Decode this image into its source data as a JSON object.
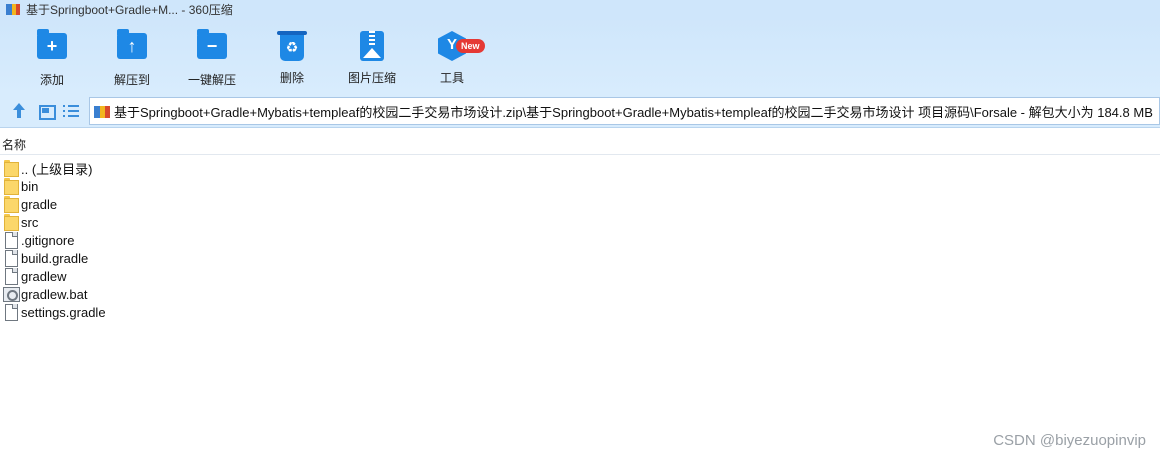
{
  "window": {
    "title": "基于Springboot+Gradle+M... - 360压缩",
    "app_icon": "zip-archive-icon"
  },
  "toolbar": {
    "buttons": [
      {
        "label": "添加",
        "icon": "add-folder-icon"
      },
      {
        "label": "解压到",
        "icon": "extract-to-icon"
      },
      {
        "label": "一键解压",
        "icon": "one-click-extract-icon"
      },
      {
        "label": "删除",
        "icon": "recycle-bin-icon"
      },
      {
        "label": "图片压缩",
        "icon": "image-compress-icon"
      },
      {
        "label": "工具",
        "icon": "tools-cube-icon",
        "badge": "New"
      }
    ],
    "accent_color": "#1e88e5",
    "badge_color": "#e53935"
  },
  "navbar": {
    "buttons": [
      "up-arrow-icon",
      "thumbnail-view-icon",
      "list-view-icon"
    ],
    "address": "基于Springboot+Gradle+Mybatis+templeaf的校园二手交易市场设计.zip\\基于Springboot+Gradle+Mybatis+templeaf的校园二手交易市场设计 项目源码\\Forsale - 解包大小为 184.8 MB"
  },
  "file_list": {
    "column_header": "名称",
    "items": [
      {
        "name": ".. (上级目录)",
        "type": "folder"
      },
      {
        "name": "bin",
        "type": "folder"
      },
      {
        "name": "gradle",
        "type": "folder"
      },
      {
        "name": "src",
        "type": "folder"
      },
      {
        "name": ".gitignore",
        "type": "file"
      },
      {
        "name": "build.gradle",
        "type": "file"
      },
      {
        "name": "gradlew",
        "type": "file"
      },
      {
        "name": "gradlew.bat",
        "type": "bat"
      },
      {
        "name": "settings.gradle",
        "type": "file"
      }
    ]
  },
  "watermark": "CSDN @biyezuopinvip"
}
